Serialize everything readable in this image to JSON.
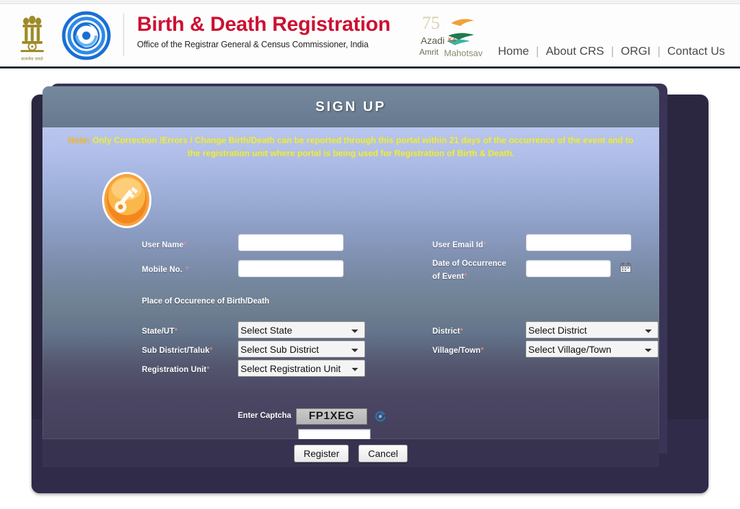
{
  "header": {
    "title": "Birth & Death Registration",
    "subtitle": "Office of the Registrar General & Census Commissioner, India",
    "emblem_caption": "सत्यमेव जयते",
    "azadi_line1": "Azadi",
    "azadi_line2": "Amrit",
    "azadi_ka": "Ka",
    "azadi_mahotsav": "Mahotsav",
    "azadi_75": "75",
    "nav": [
      {
        "label": "Home"
      },
      {
        "label": "About CRS"
      },
      {
        "label": "ORGI"
      },
      {
        "label": "Contact Us"
      }
    ],
    "nav_separator": "|"
  },
  "signup": {
    "panel_title": "SIGN UP",
    "note_lead": "Note:",
    "note_text": "Only Correction /Errors / Change Birth/Death can be reported through this portal within 21 days of the occurrence of the event and to the registration unit where portal is being used for Registration of Birth & Death.",
    "required_mark": "*",
    "fields": {
      "user_name": {
        "label": "User Name",
        "value": "",
        "placeholder": "",
        "required": true
      },
      "user_email": {
        "label": "User Email Id",
        "value": "",
        "placeholder": "",
        "required": true
      },
      "mobile_no": {
        "label": "Mobile No.",
        "value": "",
        "placeholder": "",
        "required": true
      },
      "date_of_occurrence": {
        "label_line1": "Date of Occurrence",
        "label_line2": "of Event",
        "value": "",
        "placeholder": "",
        "required": true
      }
    },
    "place_section_title": "Place of Occurence of Birth/Death",
    "selects": {
      "state": {
        "label": "State/UT",
        "selected": "Select State",
        "required": true
      },
      "district": {
        "label": "District",
        "selected": "Select District",
        "required": true
      },
      "sub_district": {
        "label": "Sub District/Taluk",
        "selected": "Select Sub District",
        "required": true
      },
      "village": {
        "label": "Village/Town",
        "selected": "Select Village/Town",
        "required": true
      },
      "registration_unit": {
        "label": "Registration Unit",
        "selected": "Select Registration Unit",
        "required": true
      }
    },
    "captcha": {
      "label": "Enter Captcha",
      "code": "FP1XEG",
      "input_value": "",
      "refresh_icon": "refresh-icon"
    },
    "buttons": {
      "register": "Register",
      "cancel": "Cancel"
    }
  },
  "colors": {
    "brand_red": "#cc1133",
    "outer_card": "#2b2741",
    "title_bar": "#6e8095",
    "note_yellow": "#f2f24a",
    "required_red": "#ff8a8a"
  }
}
